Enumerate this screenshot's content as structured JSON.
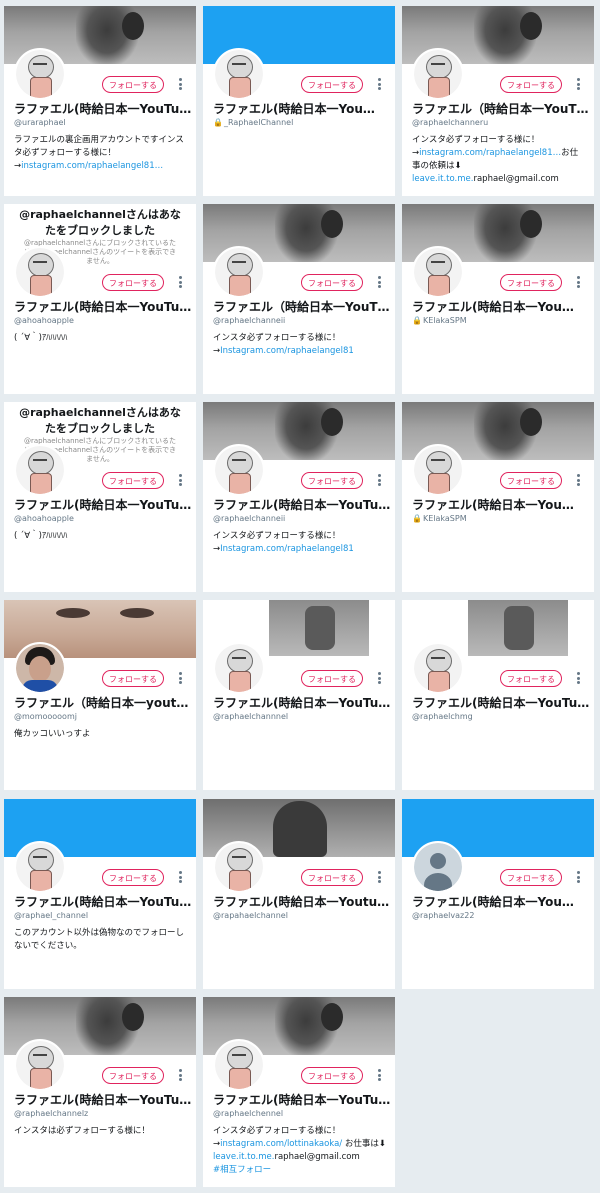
{
  "follow_label": "フォローする",
  "colors": {
    "twitter_blue": "#1da1f2",
    "follow_red": "#e0245e",
    "link_blue": "#1b95e0",
    "page_bg": "#e6ecf0"
  },
  "blocked_notice": {
    "title": "@raphaelchannelさんはあなたをブロックしました",
    "sub": "@raphaelchannelさんにブロックされているため、raphaelchannelさんのツイートを表示できません。"
  },
  "cards": [
    {
      "name": "ラファエル(時給日本一YouTu…",
      "handle": "@uraraphael",
      "bio1": "ラファエルの裏企画用アカウントですインスタ必ずフォローする様に！→",
      "link1": "instagram.com/raphaelangel81…"
    },
    {
      "name": "ラファエル(時給日本一You…",
      "handle": "_RaphaelChannel"
    },
    {
      "name": "ラファエル（時給日本一YouT…",
      "handle": "@raphaelchanneru",
      "bio1": "インスタ必ずフォローする様に！→",
      "link1": "instagram.com/raphaelangel81…",
      "bio2": "お仕事の依頼は⬇",
      "link2": "leave.it.to.me.",
      "bio3": "raphael@gmail.com"
    },
    {
      "name": "ラファエル(時給日本一YouTu…",
      "handle": "@ahoahoapple",
      "bio1": "( ´∀｀)ｱﾊﾊﾊﾊﾊ"
    },
    {
      "name": "ラファエル（時給日本一YouT…",
      "handle": "@raphaelchanneii",
      "bio1": "インスタ必ずフォローする様に！→",
      "link1": "Instagram.com/raphaelangel81"
    },
    {
      "name": "ラファエル(時給日本一You…",
      "handle": "KElakaSPM"
    },
    {
      "name": "ラファエル(時給日本一YouTu…",
      "handle": "@ahoahoapple",
      "bio1": "( ´∀｀)ｱﾊﾊﾊﾊﾊ"
    },
    {
      "name": "ラファエル(時給日本一YouTu…",
      "handle": "@raphaelchanneii",
      "bio1": "インスタ必ずフォローする様に！→",
      "link1": "Instagram.com/raphaelangel81"
    },
    {
      "name": "ラファエル(時給日本一You…",
      "handle": "KElakaSPM"
    },
    {
      "name": "ラファエル（時給日本一yout…",
      "handle": "@momooooomj",
      "bio1": "俺カッコいいっすよ"
    },
    {
      "name": "ラファエル(時給日本一YouTu…",
      "handle": "@raphaelchannnel"
    },
    {
      "name": "ラファエル(時給日本一YouTu…",
      "handle": "@raphaelchmg"
    },
    {
      "name": "ラファエル(時給日本一YouTu…",
      "handle": "@raphael_channel",
      "bio1": "このアカウント以外は偽物なのでフォローしないでください。"
    },
    {
      "name": "ラファエル(時給日本一Youtu…",
      "handle": "@rapahaelchannel"
    },
    {
      "name": "ラファエル(時給日本一You…",
      "handle": "@raphaelvaz22"
    },
    {
      "name": "ラファエル(時給日本一YouTu…",
      "handle": "@raphaelchannelz",
      "bio1": "インスタは必ずフォローする様に！"
    },
    {
      "name": "ラファエル(時給日本一YouTu…",
      "handle": "@raphaelchennel",
      "bio1": "インスタ必ずフォローする様に！→",
      "link1": "instagram.com/lottinakaoka/",
      "bio2": " お仕事は⬇ ",
      "link2": "leave.it.to.me.",
      "bio3": "raphael@gmail.com",
      "link3": "#相互フォロー"
    }
  ]
}
